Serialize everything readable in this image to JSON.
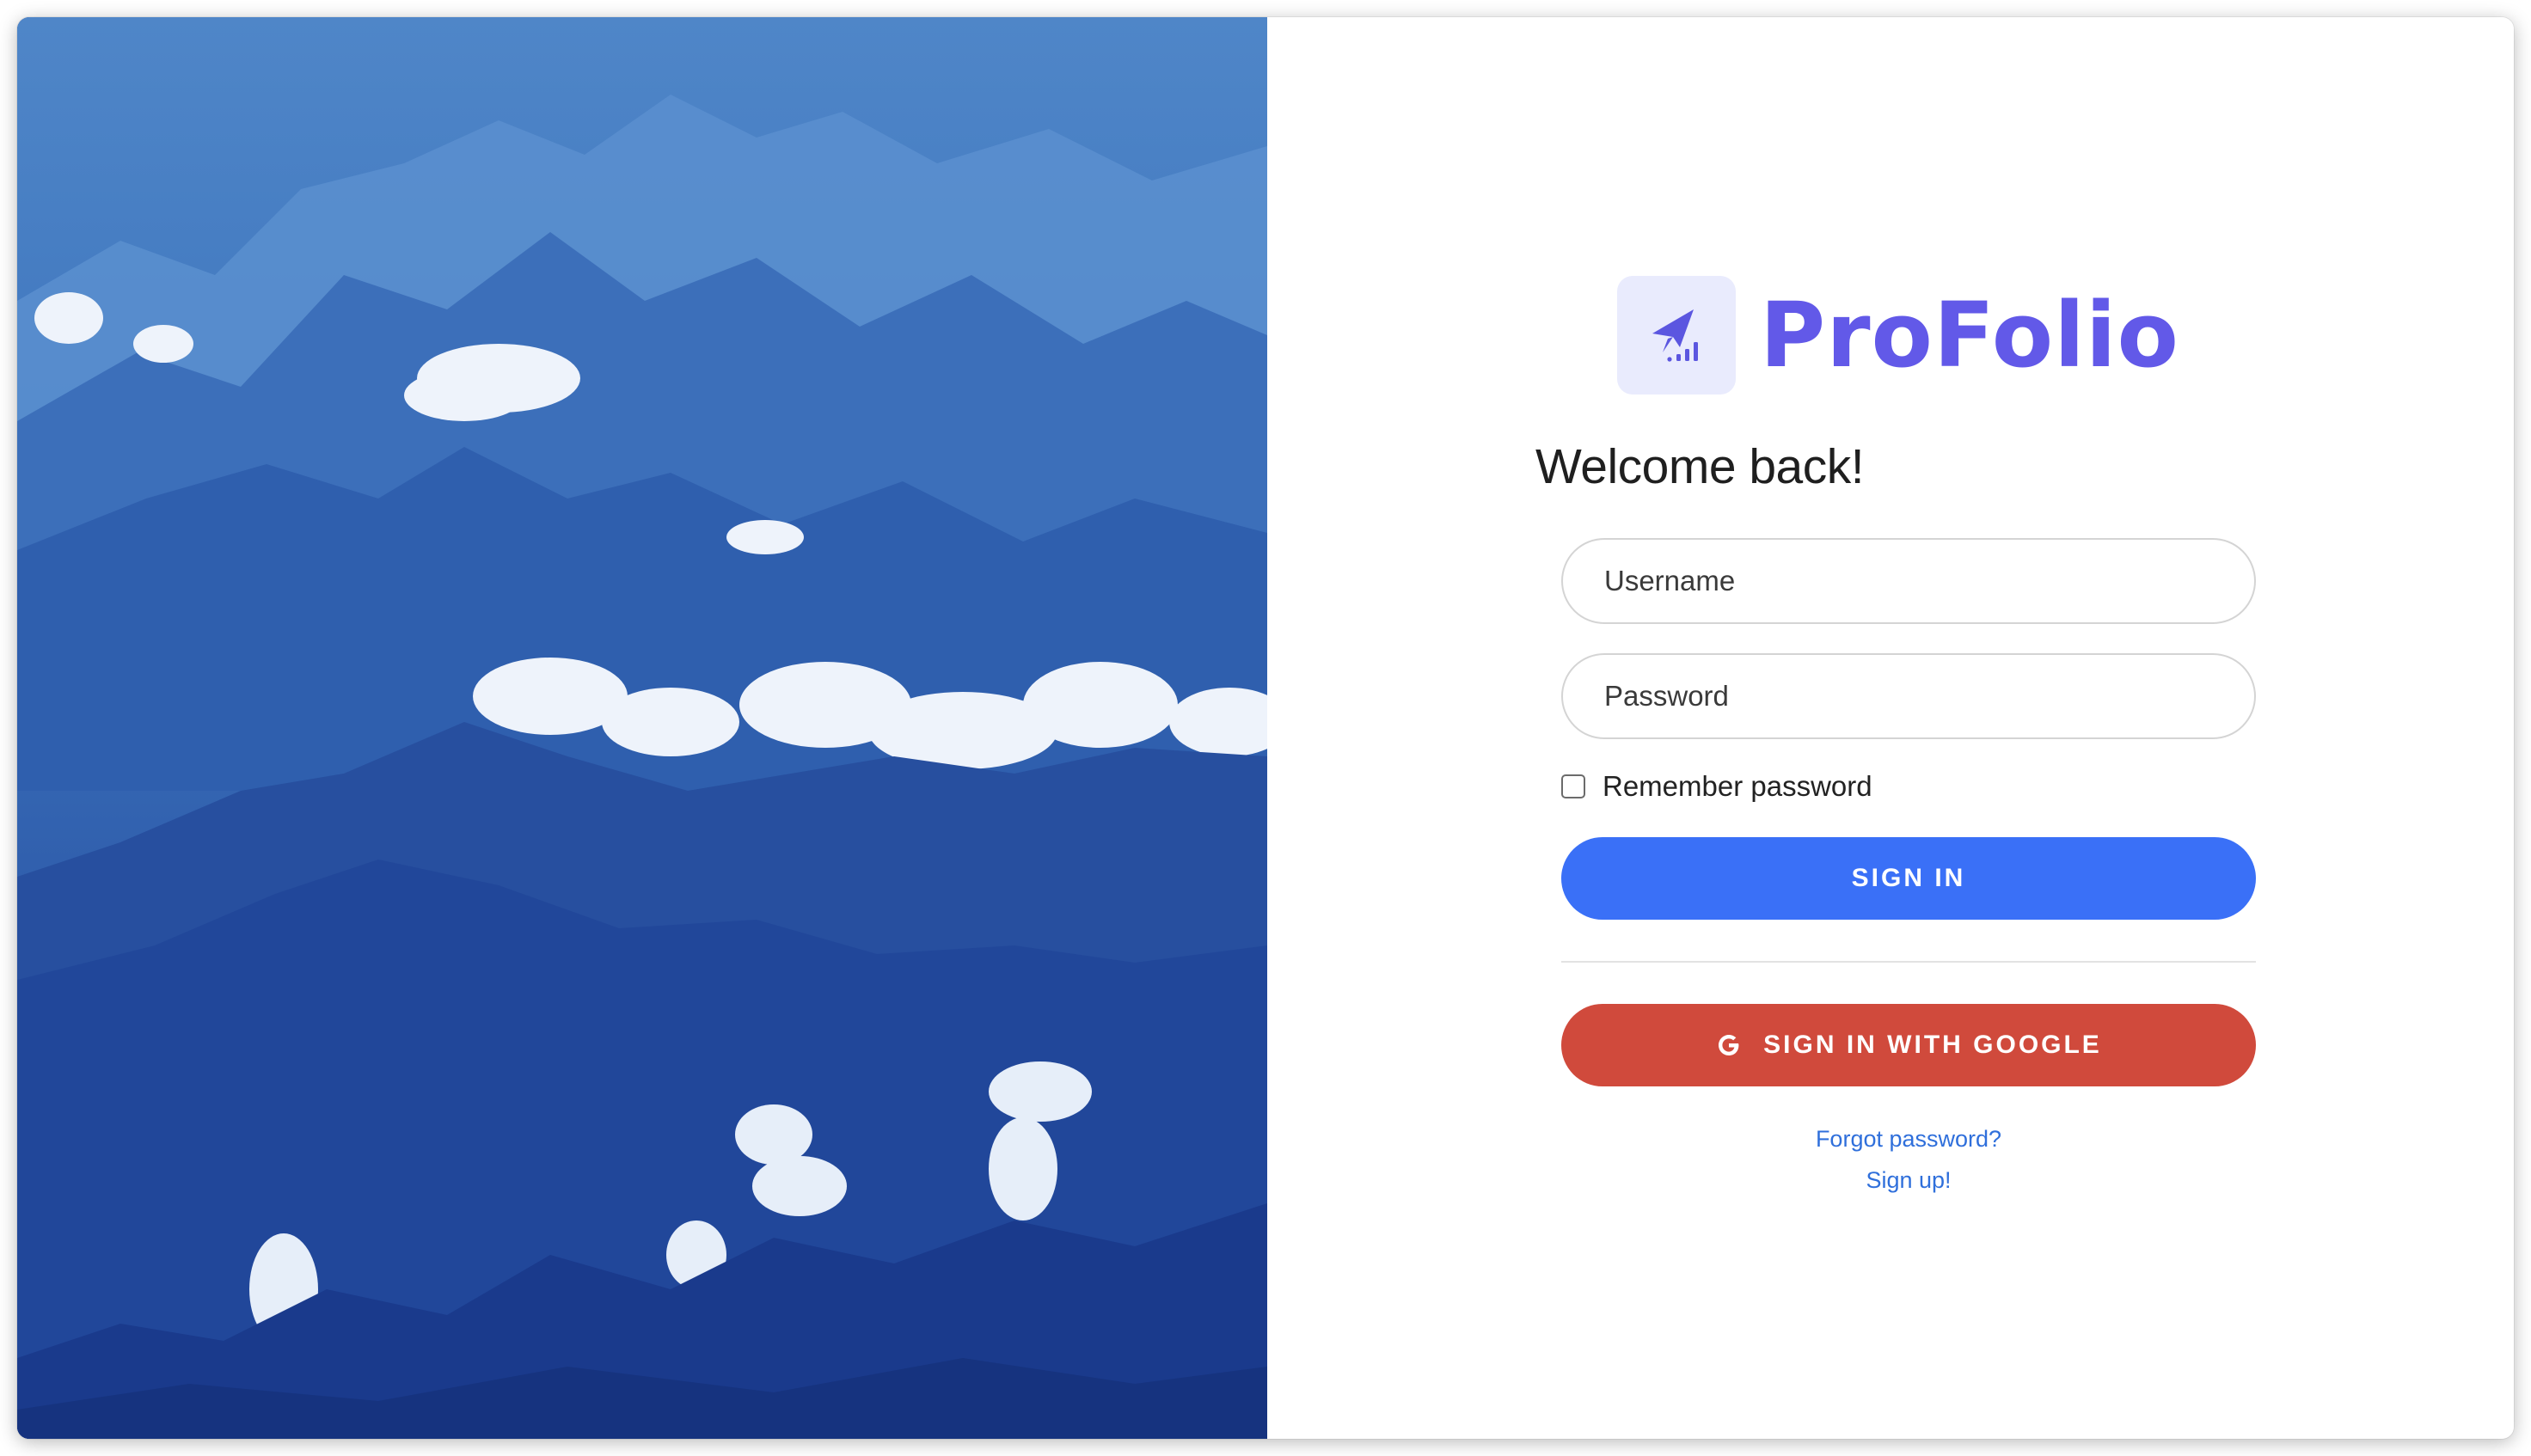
{
  "brand": {
    "name": "ProFolio",
    "accent_color": "#6259e8",
    "logo_icon": "rocket-chart-icon"
  },
  "hero": {
    "image": "blue-mountains-clouds-landscape"
  },
  "login": {
    "heading": "Welcome back!",
    "username_placeholder": "Username",
    "password_placeholder": "Password",
    "remember_label": "Remember password",
    "remember_checked": false,
    "signin_label": "SIGN IN",
    "signin_color": "#3a70f7",
    "google_label": "SIGN IN WITH GOOGLE",
    "google_color": "#d04a3c",
    "google_icon": "google-g-icon",
    "forgot_link": "Forgot password?",
    "signup_link": "Sign up!"
  }
}
